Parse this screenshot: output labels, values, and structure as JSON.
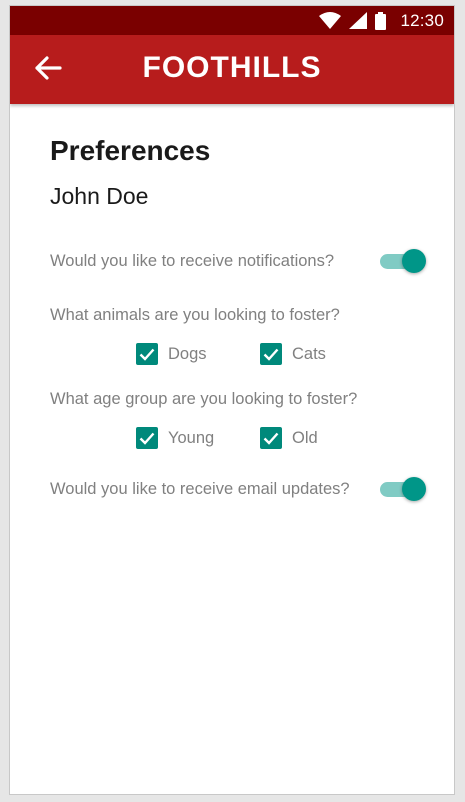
{
  "status_bar": {
    "time": "12:30",
    "icons": [
      "wifi-icon",
      "signal-icon",
      "battery-icon"
    ]
  },
  "app_bar": {
    "title": "FOOTHILLS",
    "back_icon": "arrow-left-icon"
  },
  "page": {
    "title": "Preferences",
    "user_name": "John Doe"
  },
  "preferences": {
    "notifications": {
      "question": "Would you like to receive notifications?",
      "enabled": true
    },
    "animals": {
      "question": "What animals are you looking to foster?",
      "options": [
        {
          "label": "Dogs",
          "checked": true
        },
        {
          "label": "Cats",
          "checked": true
        }
      ]
    },
    "age_group": {
      "question": "What age group are you looking to foster?",
      "options": [
        {
          "label": "Young",
          "checked": true
        },
        {
          "label": "Old",
          "checked": true
        }
      ]
    },
    "email_updates": {
      "question": "Would you like to receive email updates?",
      "enabled": true
    }
  },
  "colors": {
    "status_bar": "#7a0000",
    "app_bar": "#b71c1c",
    "accent": "#009688",
    "accent_light": "#80cbc4",
    "checkbox": "#00897b"
  }
}
